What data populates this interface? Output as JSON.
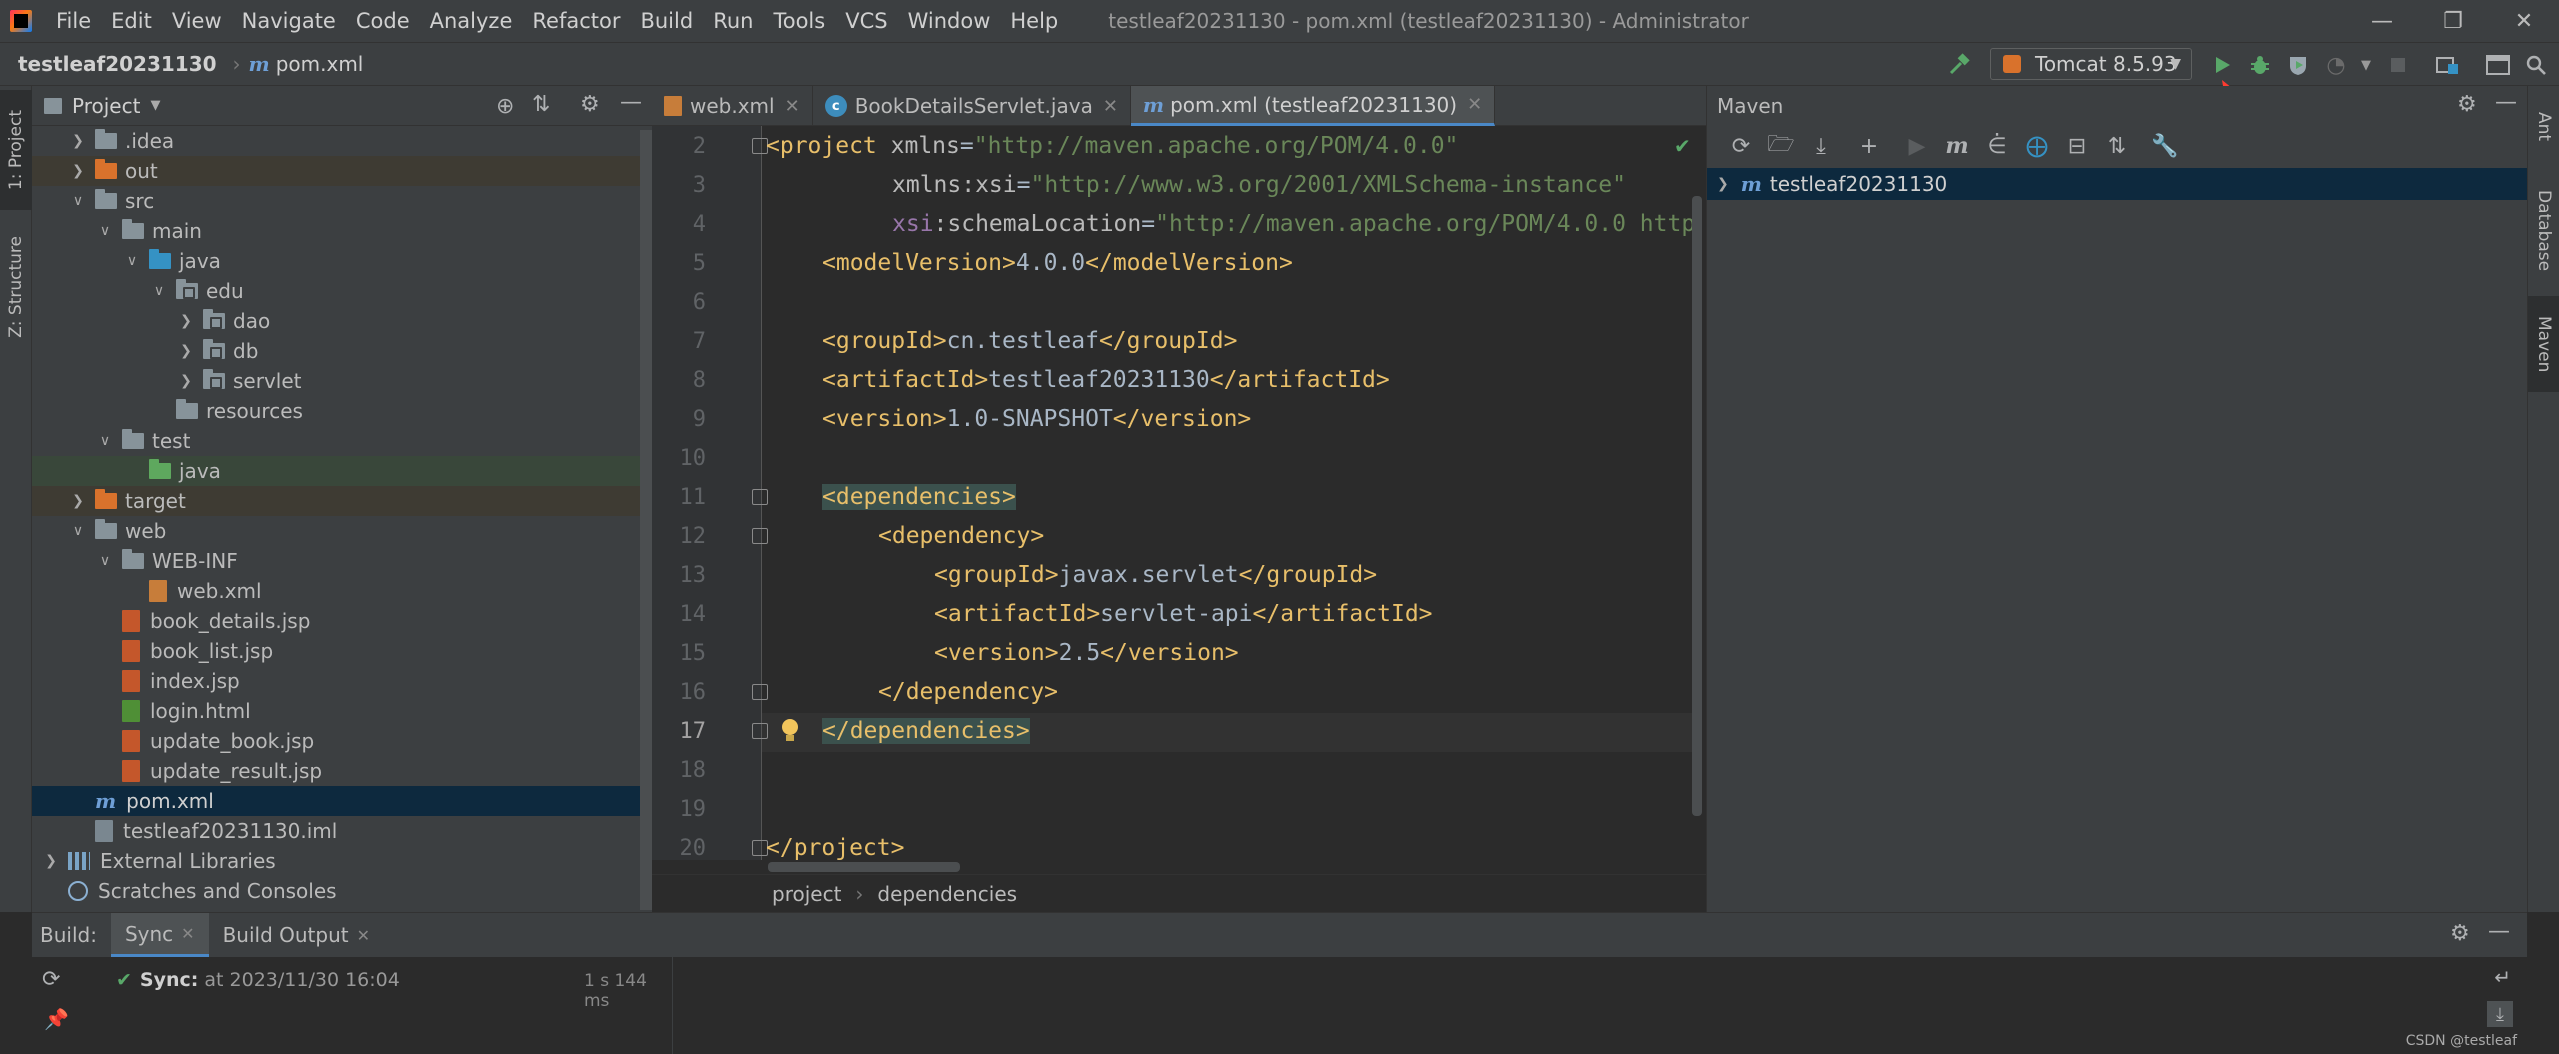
{
  "titlebar": {
    "menu": [
      "File",
      "Edit",
      "View",
      "Navigate",
      "Code",
      "Analyze",
      "Refactor",
      "Build",
      "Run",
      "Tools",
      "VCS",
      "Window",
      "Help"
    ],
    "window_title": "testleaf20231130 - pom.xml (testleaf20231130) - Administrator"
  },
  "navbar": {
    "project": "testleaf20231130",
    "file": "pom.xml",
    "run_config": "Tomcat 8.5.93"
  },
  "left_strip": {
    "project_tab": "1: Project",
    "structure_tab": "Z: Structure"
  },
  "right_strip": {
    "ant_tab": "Ant",
    "database_tab": "Database",
    "maven_tab": "Maven"
  },
  "project_panel": {
    "title": "Project",
    "tree": [
      {
        "label": ".idea",
        "depth": 1,
        "icon": "folder",
        "expander": "collapsed"
      },
      {
        "label": "out",
        "depth": 1,
        "icon": "folder-orange",
        "expander": "collapsed",
        "style": "excluded"
      },
      {
        "label": "src",
        "depth": 1,
        "icon": "folder",
        "expander": "expanded"
      },
      {
        "label": "main",
        "depth": 2,
        "icon": "folder",
        "expander": "expanded"
      },
      {
        "label": "java",
        "depth": 3,
        "icon": "folder-blue",
        "expander": "expanded"
      },
      {
        "label": "edu",
        "depth": 4,
        "icon": "package",
        "expander": "expanded"
      },
      {
        "label": "dao",
        "depth": 5,
        "icon": "package",
        "expander": "collapsed"
      },
      {
        "label": "db",
        "depth": 5,
        "icon": "package",
        "expander": "collapsed"
      },
      {
        "label": "servlet",
        "depth": 5,
        "icon": "package",
        "expander": "collapsed"
      },
      {
        "label": "resources",
        "depth": 4,
        "icon": "folder",
        "expander": "none"
      },
      {
        "label": "test",
        "depth": 2,
        "icon": "folder",
        "expander": "expanded"
      },
      {
        "label": "java",
        "depth": 3,
        "icon": "folder-green",
        "expander": "none",
        "style": "test"
      },
      {
        "label": "target",
        "depth": 1,
        "icon": "folder-orange",
        "expander": "collapsed",
        "style": "excluded"
      },
      {
        "label": "web",
        "depth": 1,
        "icon": "folder",
        "expander": "expanded"
      },
      {
        "label": "WEB-INF",
        "depth": 2,
        "icon": "folder",
        "expander": "expanded"
      },
      {
        "label": "web.xml",
        "depth": 3,
        "icon": "xml-file",
        "expander": "none"
      },
      {
        "label": "book_details.jsp",
        "depth": 2,
        "icon": "jsp-file",
        "expander": "none"
      },
      {
        "label": "book_list.jsp",
        "depth": 2,
        "icon": "jsp-file",
        "expander": "none"
      },
      {
        "label": "index.jsp",
        "depth": 2,
        "icon": "jsp-file",
        "expander": "none"
      },
      {
        "label": "login.html",
        "depth": 2,
        "icon": "html-file",
        "expander": "none"
      },
      {
        "label": "update_book.jsp",
        "depth": 2,
        "icon": "jsp-file",
        "expander": "none"
      },
      {
        "label": "update_result.jsp",
        "depth": 2,
        "icon": "jsp-file",
        "expander": "none"
      },
      {
        "label": "pom.xml",
        "depth": 1,
        "icon": "maven-file",
        "expander": "none",
        "style": "selected"
      },
      {
        "label": "testleaf20231130.iml",
        "depth": 1,
        "icon": "iml-file",
        "expander": "none"
      },
      {
        "label": "External Libraries",
        "depth": 0,
        "icon": "library",
        "expander": "collapsed"
      },
      {
        "label": "Scratches and Consoles",
        "depth": 0,
        "icon": "scratch",
        "expander": "none"
      }
    ]
  },
  "editor": {
    "tabs": [
      {
        "label": "web.xml",
        "active": false
      },
      {
        "label": "BookDetailsServlet.java",
        "active": false
      },
      {
        "label": "pom.xml (testleaf20231130)",
        "active": true
      }
    ],
    "line_numbers": [
      "2",
      "3",
      "4",
      "5",
      "6",
      "7",
      "8",
      "9",
      "10",
      "11",
      "12",
      "13",
      "14",
      "15",
      "16",
      "17",
      "18",
      "19",
      "20"
    ],
    "current_line": "17",
    "code": {
      "l2_tag": "<project",
      "l2_attr": " xmlns",
      "l2_eq": "=",
      "l2_val": "\"http://maven.apache.org/POM/4.0.0\"",
      "l3_ns": "xmlns:xsi",
      "l3_eq": "=",
      "l3_val": "\"http://www.w3.org/2001/XMLSchema-instance\"",
      "l4_ns": "xsi",
      "l4_attr": ":schemaLocation",
      "l4_eq": "=",
      "l4_val": "\"http://maven.apache.org/POM/4.0.0 http",
      "l5_open": "<modelVersion>",
      "l5_text": "4.0.0",
      "l5_close": "</modelVersion>",
      "l7_open": "<groupId>",
      "l7_text": "cn.testleaf",
      "l7_close": "</groupId>",
      "l8_open": "<artifactId>",
      "l8_text": "testleaf20231130",
      "l8_close": "</artifactId>",
      "l9_open": "<version>",
      "l9_text": "1.0-SNAPSHOT",
      "l9_close": "</version>",
      "l11": "<dependencies>",
      "l12": "<dependency>",
      "l13_open": "<groupId>",
      "l13_text": "javax.servlet",
      "l13_close": "</groupId>",
      "l14_open": "<artifactId>",
      "l14_text": "servlet-api",
      "l14_close": "</artifactId>",
      "l15_open": "<version>",
      "l15_text": "2.5",
      "l15_close": "</version>",
      "l16": "</dependency>",
      "l17": "</dependencies>",
      "l20": "</project>"
    },
    "breadcrumbs": [
      "project",
      "dependencies"
    ]
  },
  "maven_panel": {
    "title": "Maven",
    "toolbar_icons": [
      "reload-icon",
      "add-folder-icon",
      "download-icon",
      "plus-icon",
      "run-icon",
      "maven-goal-icon",
      "toggle-offline-icon",
      "skip-tests-icon",
      "show-dependencies-icon",
      "collapse-icon",
      "wrench-icon"
    ],
    "root": "testleaf20231130"
  },
  "build_panel": {
    "label": "Build:",
    "tabs": [
      "Sync",
      "Build Output"
    ],
    "sync_label": "Sync:",
    "sync_text": "at 2023/11/30 16:04",
    "duration": "1 s 144 ms"
  },
  "watermark": "CSDN @testleaf",
  "colors": {
    "background": "#2b2b2b",
    "panel": "#3c3f41",
    "selection": "#0d293e",
    "tag": "#e8bf6a",
    "attr_value": "#6a8759",
    "namespace": "#9876aa",
    "run_green": "#59a869",
    "annotation_arrow": "#ff3b30"
  }
}
